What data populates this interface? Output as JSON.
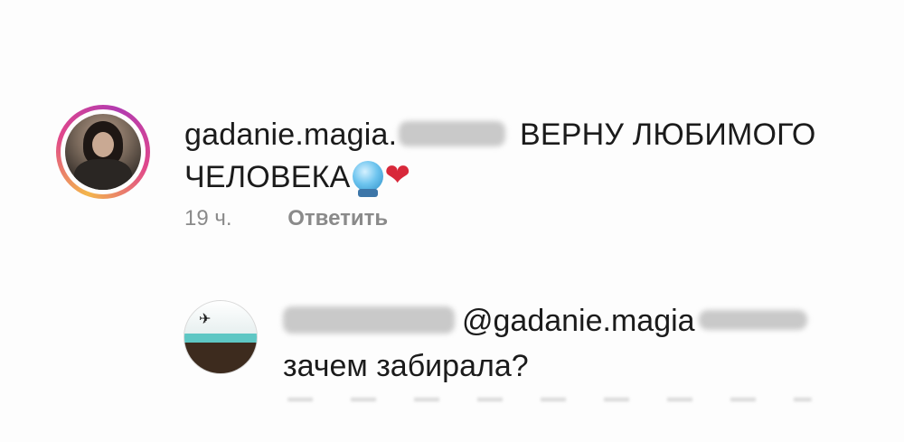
{
  "comment": {
    "username": "gadanie.magia.",
    "text_line1": "ВЕРНУ ЛЮБИМОГО",
    "text_line2": "ЧЕЛОВЕКА",
    "emojis": [
      "crystal-ball-icon",
      "heart-icon"
    ],
    "heart_glyph": "❤",
    "time": "19 ч.",
    "reply_label": "Ответить"
  },
  "reply": {
    "mention": "@gadanie.magia",
    "text": "зачем забирала?"
  },
  "colors": {
    "heart": "#d8283a",
    "meta_text": "#8a8a8a",
    "story_ring": [
      "#f3b64b",
      "#e0478b",
      "#b23bb0"
    ]
  }
}
